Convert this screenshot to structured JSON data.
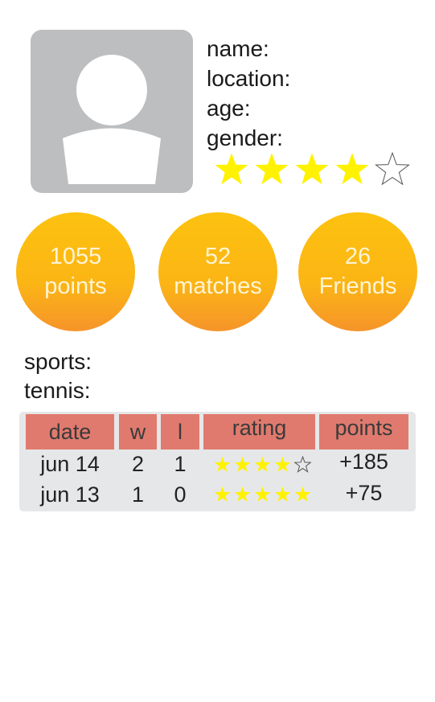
{
  "profile": {
    "avatar_icon": "user-silhouette-icon",
    "fields": {
      "name_label": "name:",
      "location_label": "location:",
      "age_label": "age:",
      "gender_label": "gender:"
    },
    "rating": {
      "filled": 4,
      "total": 5
    },
    "star_color": "#fff200"
  },
  "stats": {
    "points": {
      "value": "1055",
      "label": "points"
    },
    "matches": {
      "value": "52",
      "label": "matches"
    },
    "friends": {
      "value": "26",
      "label": "Friends"
    }
  },
  "sports": {
    "sports_label": "sports:",
    "sport_label": "tennis:"
  },
  "table": {
    "header_color": "#e07a6e",
    "headers": {
      "date": "date",
      "w": "w",
      "l": "l",
      "rating": "rating",
      "points": "points"
    },
    "rows": [
      {
        "date": "jun 14",
        "w": "2",
        "l": "1",
        "rating": 4,
        "points": "+185"
      },
      {
        "date": "jun 13",
        "w": "1",
        "l": "0",
        "rating": 5,
        "points": "+75"
      }
    ]
  }
}
